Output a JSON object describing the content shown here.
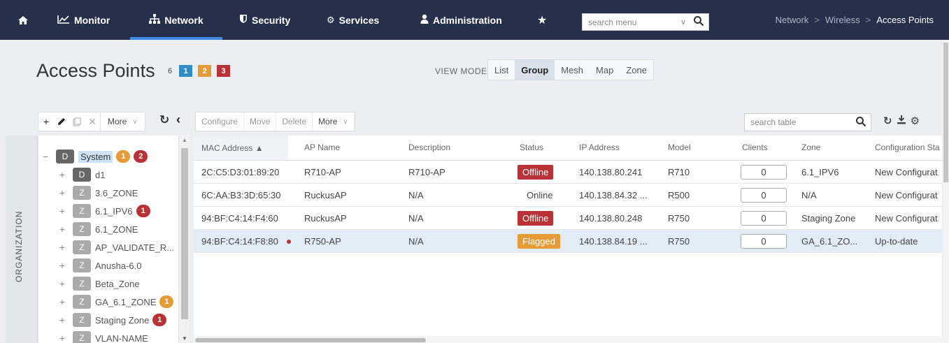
{
  "nav": {
    "home_icon": "home-icon",
    "items": [
      {
        "label": "Monitor",
        "icon": "chart-line-icon"
      },
      {
        "label": "Network",
        "icon": "sitemap-icon",
        "active": true
      },
      {
        "label": "Security",
        "icon": "shield-icon"
      },
      {
        "label": "Services",
        "icon": "gears-icon"
      },
      {
        "label": "Administration",
        "icon": "user-icon"
      }
    ],
    "star_icon": "star-icon",
    "search_placeholder": "search menu",
    "breadcrumb": [
      "Network",
      "Wireless",
      "Access Points"
    ]
  },
  "page": {
    "title": "Access Points",
    "count_total": "6",
    "counts": [
      "1",
      "2",
      "3"
    ],
    "count_colors": [
      "#2f8ec4",
      "#e79b35",
      "#b83236"
    ],
    "view_mode_label": "VIEW MODE:",
    "view_modes": [
      "List",
      "Group",
      "Mesh",
      "Map",
      "Zone"
    ],
    "view_mode_selected": "Group"
  },
  "left_toolbar": {
    "more_label": "More"
  },
  "org_tab_label": "ORGANIZATION",
  "tree": {
    "root": {
      "tag": "D",
      "label": "System",
      "badges": [
        "1",
        "2"
      ]
    },
    "items": [
      {
        "tag": "D",
        "label": "d1",
        "badge": null
      },
      {
        "tag": "Z",
        "label": "3.6_ZONE",
        "badge": null
      },
      {
        "tag": "Z",
        "label": "6.1_IPV6",
        "badge": "1"
      },
      {
        "tag": "Z",
        "label": "6.1_ZONE",
        "badge": null
      },
      {
        "tag": "Z",
        "label": "AP_VALIDATE_R...",
        "badge": null
      },
      {
        "tag": "Z",
        "label": "Anusha-6.0",
        "badge": null
      },
      {
        "tag": "Z",
        "label": "Beta_Zone",
        "badge": null
      },
      {
        "tag": "Z",
        "label": "GA_6.1_ZONE",
        "badge": "1"
      },
      {
        "tag": "Z",
        "label": "Staging Zone",
        "badge": "1"
      },
      {
        "tag": "Z",
        "label": "VLAN-NAME",
        "badge": null
      }
    ]
  },
  "right_toolbar": {
    "configure": "Configure",
    "move": "Move",
    "delete": "Delete",
    "more": "More",
    "search_placeholder": "search table"
  },
  "table": {
    "columns": [
      "MAC Address ▲",
      "AP Name",
      "Description",
      "Status",
      "IP Address",
      "Model",
      "Clients",
      "Zone",
      "Configuration Sta"
    ],
    "rows": [
      {
        "mac": "2C:C5:D3:01:89:20",
        "flag": false,
        "name": "R710-AP",
        "desc": "R710-AP",
        "status": "Offline",
        "ip": "140.138.80.241",
        "model": "R710",
        "clients": "0",
        "zone": "6.1_IPV6",
        "config": "New Configurat"
      },
      {
        "mac": "6C:AA:B3:3D:65:30",
        "flag": false,
        "name": "RuckusAP",
        "desc": "N/A",
        "status": "Online",
        "ip": "140.138.84.32 ...",
        "model": "R500",
        "clients": "0",
        "zone": "N/A",
        "config": "New Configurat"
      },
      {
        "mac": "94:BF:C4:14:F4:60",
        "flag": false,
        "name": "RuckusAP",
        "desc": "N/A",
        "status": "Offline",
        "ip": "140.138.80.248",
        "model": "R750",
        "clients": "0",
        "zone": "Staging Zone",
        "config": "New Configurat"
      },
      {
        "mac": "94:BF:C4:14:F8:80",
        "flag": true,
        "name": "R750-AP",
        "desc": "N/A",
        "status": "Flagged",
        "ip": "140.138.84.19 ...",
        "model": "R750",
        "clients": "0",
        "zone": "GA_6.1_ZO...",
        "config": "Up-to-date"
      }
    ]
  }
}
